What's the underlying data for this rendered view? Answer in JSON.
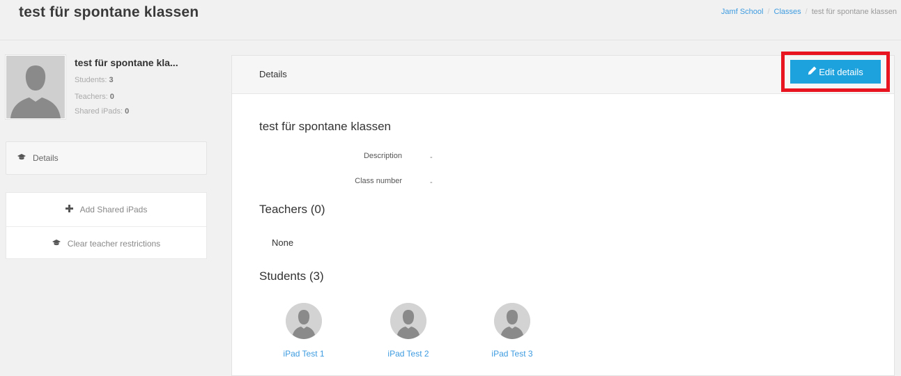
{
  "header": {
    "title": "test für spontane klassen",
    "breadcrumb": [
      "Jamf School",
      "Classes",
      "test für spontane klassen"
    ]
  },
  "profile": {
    "name": "test für spontane kla...",
    "students_label": "Students:",
    "students_count": "3",
    "teachers_label": "Teachers:",
    "teachers_count": "0",
    "shared_label": "Shared iPads:",
    "shared_count": "0"
  },
  "sidebar": {
    "nav_details": "Details",
    "add_shared": "Add Shared iPads",
    "clear_restrictions": "Clear teacher restrictions"
  },
  "panel": {
    "title": "Details",
    "edit_label": "Edit details",
    "class_name": "test für spontane klassen",
    "description_label": "Description",
    "description_value": "-",
    "class_number_label": "Class number",
    "class_number_value": "-",
    "teachers_heading": "Teachers (0)",
    "teachers_none": "None",
    "students_heading": "Students (3)",
    "students": [
      "iPad Test 1",
      "iPad Test 2",
      "iPad Test 3"
    ]
  },
  "colors": {
    "accent": "#1ea2dd",
    "highlight": "#e8141f",
    "link": "#3d9be0"
  }
}
